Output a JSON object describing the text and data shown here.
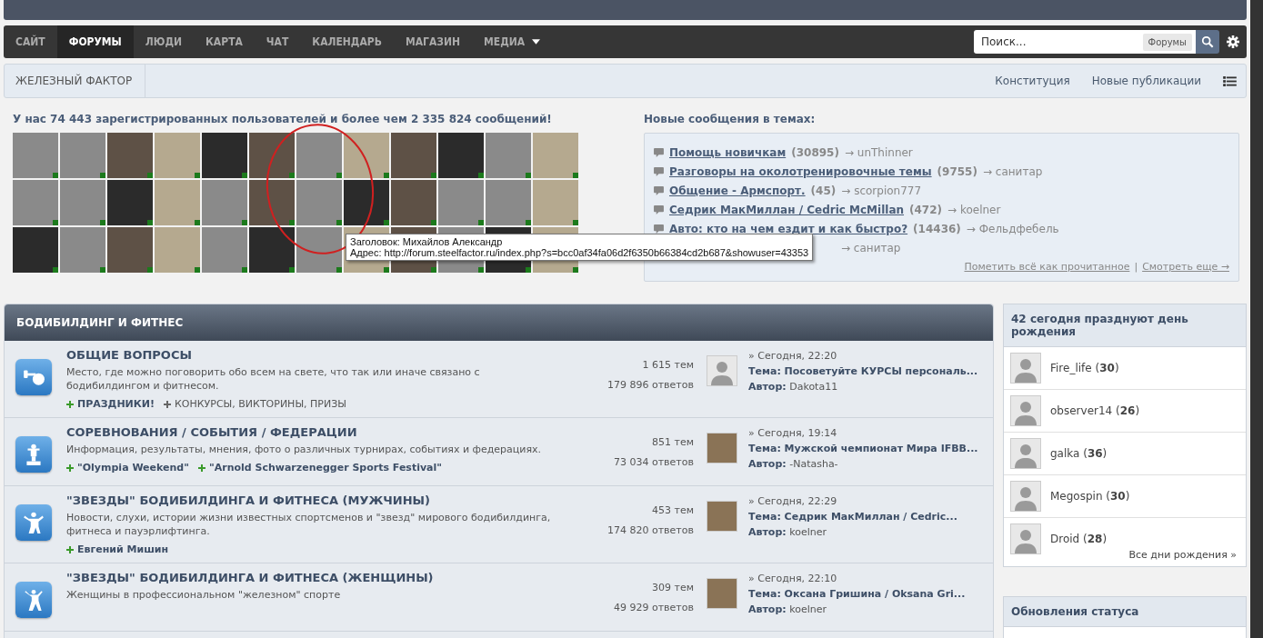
{
  "nav": {
    "tabs": [
      {
        "label": "САЙТ",
        "selected": false
      },
      {
        "label": "ФОРУМЫ",
        "selected": true
      },
      {
        "label": "ЛЮДИ",
        "selected": false
      },
      {
        "label": "КАРТА",
        "selected": false
      },
      {
        "label": "ЧАТ",
        "selected": false
      },
      {
        "label": "КАЛЕНДАРЬ",
        "selected": false
      },
      {
        "label": "МАГАЗИН",
        "selected": false
      },
      {
        "label": "МЕДИА",
        "selected": false,
        "dropdown": true
      }
    ],
    "search": {
      "placeholder": "Поиск...",
      "scope": "Форумы"
    }
  },
  "breadcrumb": {
    "items": [
      "ЖЕЛЕЗНЫЙ ФАКТОР"
    ],
    "links": [
      "Конституция",
      "Новые публикации"
    ]
  },
  "stats": {
    "title": "У нас 74 443 зарегистрированных пользователей и более чем 2 335 824 сообщений!",
    "avatars": [
      {
        "online": true
      },
      {
        "online": true
      },
      {
        "online": true
      },
      {
        "online": true
      },
      {
        "online": true
      },
      {
        "online": true
      },
      {
        "online": true
      },
      {
        "online": true
      },
      {
        "online": true
      },
      {
        "online": true
      },
      {
        "online": true
      },
      {
        "online": true
      },
      {
        "online": true
      },
      {
        "online": true
      },
      {
        "online": true
      },
      {
        "online": true
      },
      {
        "online": true
      },
      {
        "online": true
      },
      {
        "online": true
      },
      {
        "online": true
      },
      {
        "online": true
      },
      {
        "online": true
      },
      {
        "online": true
      },
      {
        "online": true
      },
      {
        "online": true
      },
      {
        "online": true
      },
      {
        "online": true
      },
      {
        "online": true
      },
      {
        "online": true
      },
      {
        "online": true
      },
      {
        "online": true
      },
      {
        "online": true
      },
      {
        "online": true
      },
      {
        "online": true
      },
      {
        "online": true
      },
      {
        "online": true
      }
    ]
  },
  "new_posts": {
    "title": "Новые сообщения в темах:",
    "topics": [
      {
        "title": "Помощь новичкам",
        "count": "(30895)",
        "author": "→ unThinner"
      },
      {
        "title": "Разговоры на околотренировочные темы",
        "count": "(9755)",
        "author": "→ санитар"
      },
      {
        "title": "Общение - Армспорт.",
        "count": "(45)",
        "author": "→ scorpion777"
      },
      {
        "title": "Седрик МакМиллан / Cedric McMillan",
        "count": "(472)",
        "author": "→ koelner"
      },
      {
        "title": "Авто: кто на чем ездит и как быстро?",
        "count": "(14436)",
        "author": "→ Фельдфебель"
      },
      {
        "author": "→ санитар"
      }
    ],
    "links": [
      "Пометить всё как прочитанное",
      "Смотреть еще →"
    ],
    "separator": "|"
  },
  "tooltip": {
    "lines": [
      "Заголовок: Михайлов Александр",
      "Адрес: http://forum.steelfactor.ru/index.php?s=bcc0af34fa06d2f6350b66384cd2b687&showuser=43353"
    ]
  },
  "category": {
    "title": "БОДИБИЛДИНГ И ФИТНЕС",
    "forums": [
      {
        "kind": "weights",
        "title": "ОБЩИЕ ВОПРОСЫ",
        "description": "Место, где можно поговорить обо всем на свете, что так или иначе связано с бодибилдингом и фитнесом.",
        "subforums": [
          {
            "label": "ПРАЗДНИКИ!",
            "unread": true
          },
          {
            "label": "КОНКУРСЫ, ВИКТОРИНЫ, ПРИЗЫ",
            "unread": false
          }
        ],
        "topics": "1 615 тем",
        "replies": "179 896 ответов",
        "last_avatar": {
          "kind": "silhouette"
        },
        "last_date": "» Сегодня, 22:20",
        "last_topic": "Тема: Посоветуйте КУРСЫ персональ...",
        "last_author_label": "Автор:",
        "last_author": "Dakota11"
      },
      {
        "kind": "trophy",
        "title": "СОРЕВНОВАНИЯ / СОБЫТИЯ / ФЕДЕРАЦИИ",
        "description": "Информация, результаты, мнения, фото о различных турнирах, событиях и федерациях.",
        "subforums": [
          {
            "label": "\"Olympia Weekend\"",
            "unread": true
          },
          {
            "label": "\"Arnold Schwarzenegger Sports Festival\"",
            "unread": true
          }
        ],
        "topics": "851 тем",
        "replies": "73 034 ответов",
        "last_avatar": {
          "kind": "photo"
        },
        "last_date": "» Сегодня, 19:14",
        "last_topic": "Тема: Мужской чемпионат Мира IFBB...",
        "last_author_label": "Автор:",
        "last_author": "-Natasha-"
      },
      {
        "kind": "man",
        "title": "\"ЗВЕЗДЫ\" БОДИБИЛДИНГА И ФИТНЕСА (МУЖЧИНЫ)",
        "description": "Новости, слухи, истории жизни известных спортсменов и \"звезд\" мирового бодибилдинга, фитнеса и пауэрлифтинга.",
        "subforums": [
          {
            "label": "Евгений Мишин",
            "unread": true
          }
        ],
        "topics": "453 тем",
        "replies": "174 820 ответов",
        "last_avatar": {
          "kind": "photo"
        },
        "last_date": "» Сегодня, 22:29",
        "last_topic": "Тема: Седрик МакМиллан / Cedric...",
        "last_author_label": "Автор:",
        "last_author": "koelner"
      },
      {
        "kind": "woman",
        "title": "\"ЗВЕЗДЫ\" БОДИБИЛДИНГА И ФИТНЕСА (ЖЕНЩИНЫ)",
        "description": "Женщины в профессиональном \"железном\" спорте",
        "topics": "309 тем",
        "replies": "49 929 ответов",
        "last_avatar": {
          "kind": "photo"
        },
        "last_date": "» Сегодня, 22:10",
        "last_topic": "Тема: Оксана Гришина / Oksana Gri...",
        "last_author_label": "Автор:",
        "last_author": "koelner"
      }
    ]
  },
  "birthdays": {
    "title": "42 сегодня празднуют день рождения",
    "users": [
      {
        "name": "Fire_life (**30**)"
      },
      {
        "name": "observer14 (**26**)"
      },
      {
        "name": "galka (**36**)"
      },
      {
        "name": "Megospin (**30**)"
      },
      {
        "name": "Droid (**28**)"
      }
    ],
    "more": "Все дни рождения »"
  },
  "status_updates": {
    "title": "Обновления статуса"
  }
}
